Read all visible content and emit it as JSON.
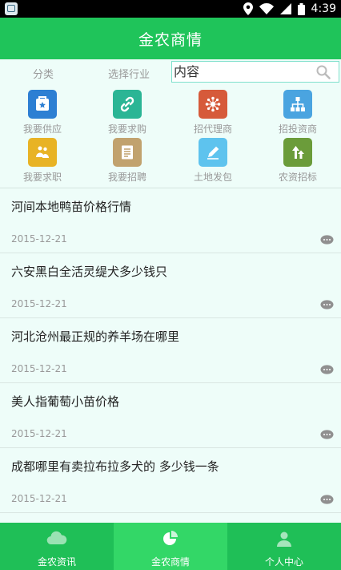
{
  "status_bar": {
    "time": "4:39"
  },
  "header": {
    "title": "金农商情"
  },
  "filters": {
    "category": "分类",
    "industry": "选择行业",
    "search_placeholder": "内容"
  },
  "grid": [
    {
      "label": "我要供应",
      "color": "#2d7fd3"
    },
    {
      "label": "我要求购",
      "color": "#2bb595"
    },
    {
      "label": "招代理商",
      "color": "#d65a3a"
    },
    {
      "label": "招投资商",
      "color": "#4aa4e0"
    },
    {
      "label": "我要求职",
      "color": "#e8b325"
    },
    {
      "label": "我要招聘",
      "color": "#c1a26e"
    },
    {
      "label": "土地发包",
      "color": "#5ec3ee"
    },
    {
      "label": "农资招标",
      "color": "#6b9c3a"
    }
  ],
  "list": [
    {
      "title": "河间本地鸭苗价格行情",
      "date": "2015-12-21"
    },
    {
      "title": "六安黑白全活灵缇犬多少钱只",
      "date": "2015-12-21"
    },
    {
      "title": "河北沧州最正规的养羊场在哪里",
      "date": "2015-12-21"
    },
    {
      "title": "美人指葡萄小苗价格",
      "date": "2015-12-21"
    },
    {
      "title": "成都哪里有卖拉布拉多犬的 多少钱一条",
      "date": "2015-12-21"
    }
  ],
  "bottom_nav": [
    {
      "label": "金农资讯"
    },
    {
      "label": "金农商情"
    },
    {
      "label": "个人中心"
    }
  ],
  "colors": {
    "primary": "#1fc45a",
    "active_tab": "#33d767",
    "background": "#eefdf9"
  }
}
